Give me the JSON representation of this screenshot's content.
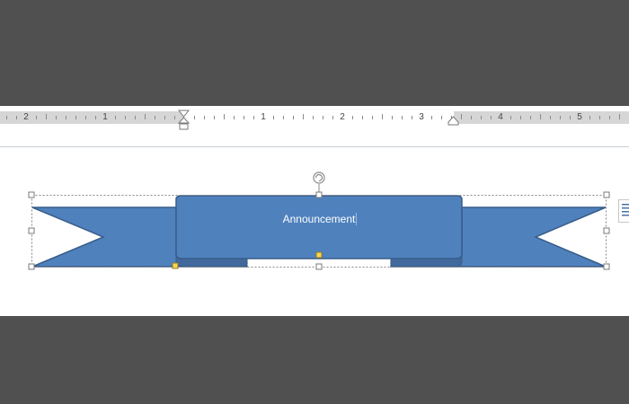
{
  "ruler": {
    "numbers": [
      "2",
      "1",
      "1",
      "2",
      "3",
      "4",
      "5"
    ]
  },
  "shape": {
    "text": "Announcement"
  },
  "colors": {
    "ribbon_fill": "#4f81bd",
    "ribbon_stroke": "#385d8a",
    "handle_adjust": "#ffd54f",
    "background": "#505050"
  },
  "icons": {
    "rotate": "rotate-handle-icon",
    "layout_options": "layout-options-icon"
  }
}
